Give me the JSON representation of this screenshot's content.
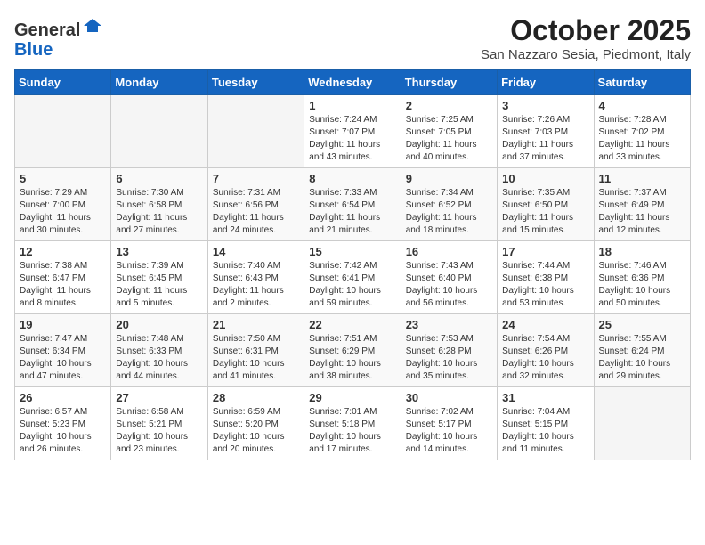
{
  "header": {
    "logo_general": "General",
    "logo_blue": "Blue",
    "month_title": "October 2025",
    "location": "San Nazzaro Sesia, Piedmont, Italy"
  },
  "days_of_week": [
    "Sunday",
    "Monday",
    "Tuesday",
    "Wednesday",
    "Thursday",
    "Friday",
    "Saturday"
  ],
  "weeks": [
    [
      {
        "day": "",
        "info": ""
      },
      {
        "day": "",
        "info": ""
      },
      {
        "day": "",
        "info": ""
      },
      {
        "day": "1",
        "info": "Sunrise: 7:24 AM\nSunset: 7:07 PM\nDaylight: 11 hours\nand 43 minutes."
      },
      {
        "day": "2",
        "info": "Sunrise: 7:25 AM\nSunset: 7:05 PM\nDaylight: 11 hours\nand 40 minutes."
      },
      {
        "day": "3",
        "info": "Sunrise: 7:26 AM\nSunset: 7:03 PM\nDaylight: 11 hours\nand 37 minutes."
      },
      {
        "day": "4",
        "info": "Sunrise: 7:28 AM\nSunset: 7:02 PM\nDaylight: 11 hours\nand 33 minutes."
      }
    ],
    [
      {
        "day": "5",
        "info": "Sunrise: 7:29 AM\nSunset: 7:00 PM\nDaylight: 11 hours\nand 30 minutes."
      },
      {
        "day": "6",
        "info": "Sunrise: 7:30 AM\nSunset: 6:58 PM\nDaylight: 11 hours\nand 27 minutes."
      },
      {
        "day": "7",
        "info": "Sunrise: 7:31 AM\nSunset: 6:56 PM\nDaylight: 11 hours\nand 24 minutes."
      },
      {
        "day": "8",
        "info": "Sunrise: 7:33 AM\nSunset: 6:54 PM\nDaylight: 11 hours\nand 21 minutes."
      },
      {
        "day": "9",
        "info": "Sunrise: 7:34 AM\nSunset: 6:52 PM\nDaylight: 11 hours\nand 18 minutes."
      },
      {
        "day": "10",
        "info": "Sunrise: 7:35 AM\nSunset: 6:50 PM\nDaylight: 11 hours\nand 15 minutes."
      },
      {
        "day": "11",
        "info": "Sunrise: 7:37 AM\nSunset: 6:49 PM\nDaylight: 11 hours\nand 12 minutes."
      }
    ],
    [
      {
        "day": "12",
        "info": "Sunrise: 7:38 AM\nSunset: 6:47 PM\nDaylight: 11 hours\nand 8 minutes."
      },
      {
        "day": "13",
        "info": "Sunrise: 7:39 AM\nSunset: 6:45 PM\nDaylight: 11 hours\nand 5 minutes."
      },
      {
        "day": "14",
        "info": "Sunrise: 7:40 AM\nSunset: 6:43 PM\nDaylight: 11 hours\nand 2 minutes."
      },
      {
        "day": "15",
        "info": "Sunrise: 7:42 AM\nSunset: 6:41 PM\nDaylight: 10 hours\nand 59 minutes."
      },
      {
        "day": "16",
        "info": "Sunrise: 7:43 AM\nSunset: 6:40 PM\nDaylight: 10 hours\nand 56 minutes."
      },
      {
        "day": "17",
        "info": "Sunrise: 7:44 AM\nSunset: 6:38 PM\nDaylight: 10 hours\nand 53 minutes."
      },
      {
        "day": "18",
        "info": "Sunrise: 7:46 AM\nSunset: 6:36 PM\nDaylight: 10 hours\nand 50 minutes."
      }
    ],
    [
      {
        "day": "19",
        "info": "Sunrise: 7:47 AM\nSunset: 6:34 PM\nDaylight: 10 hours\nand 47 minutes."
      },
      {
        "day": "20",
        "info": "Sunrise: 7:48 AM\nSunset: 6:33 PM\nDaylight: 10 hours\nand 44 minutes."
      },
      {
        "day": "21",
        "info": "Sunrise: 7:50 AM\nSunset: 6:31 PM\nDaylight: 10 hours\nand 41 minutes."
      },
      {
        "day": "22",
        "info": "Sunrise: 7:51 AM\nSunset: 6:29 PM\nDaylight: 10 hours\nand 38 minutes."
      },
      {
        "day": "23",
        "info": "Sunrise: 7:53 AM\nSunset: 6:28 PM\nDaylight: 10 hours\nand 35 minutes."
      },
      {
        "day": "24",
        "info": "Sunrise: 7:54 AM\nSunset: 6:26 PM\nDaylight: 10 hours\nand 32 minutes."
      },
      {
        "day": "25",
        "info": "Sunrise: 7:55 AM\nSunset: 6:24 PM\nDaylight: 10 hours\nand 29 minutes."
      }
    ],
    [
      {
        "day": "26",
        "info": "Sunrise: 6:57 AM\nSunset: 5:23 PM\nDaylight: 10 hours\nand 26 minutes."
      },
      {
        "day": "27",
        "info": "Sunrise: 6:58 AM\nSunset: 5:21 PM\nDaylight: 10 hours\nand 23 minutes."
      },
      {
        "day": "28",
        "info": "Sunrise: 6:59 AM\nSunset: 5:20 PM\nDaylight: 10 hours\nand 20 minutes."
      },
      {
        "day": "29",
        "info": "Sunrise: 7:01 AM\nSunset: 5:18 PM\nDaylight: 10 hours\nand 17 minutes."
      },
      {
        "day": "30",
        "info": "Sunrise: 7:02 AM\nSunset: 5:17 PM\nDaylight: 10 hours\nand 14 minutes."
      },
      {
        "day": "31",
        "info": "Sunrise: 7:04 AM\nSunset: 5:15 PM\nDaylight: 10 hours\nand 11 minutes."
      },
      {
        "day": "",
        "info": ""
      }
    ]
  ]
}
